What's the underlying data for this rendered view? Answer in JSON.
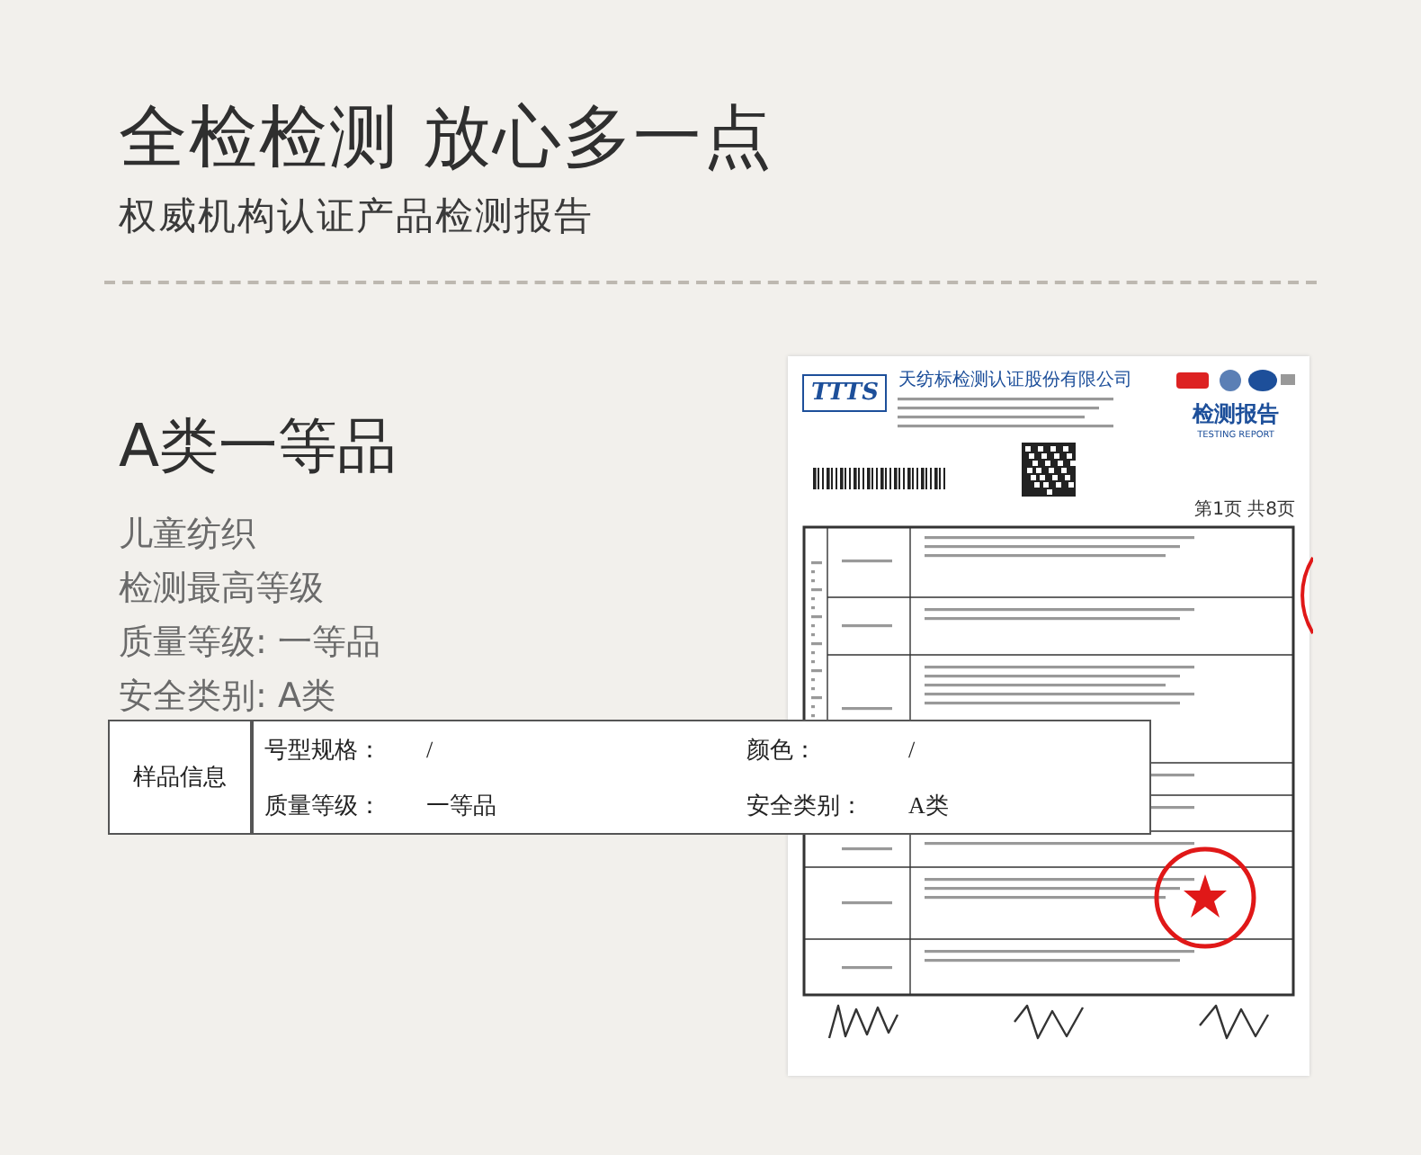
{
  "header": {
    "title": "全检检测 放心多一点",
    "subtitle": "权威机构认证产品检测报告"
  },
  "grade": {
    "title": "A类一等品",
    "items": [
      "儿童纺织",
      "检测最高等级",
      "质量等级: 一等品",
      "安全类别: A类"
    ]
  },
  "report": {
    "logo": "TTTS",
    "company": "天纺标检测认证股份有限公司",
    "title": "检测报告",
    "title_en": "TESTING REPORT",
    "page": "第1页 共8页"
  },
  "sample_info": {
    "label": "样品信息",
    "fields": [
      {
        "label": "号型规格：",
        "value": "/"
      },
      {
        "label": "颜色：",
        "value": "/"
      },
      {
        "label": "质量等级：",
        "value": "一等品"
      },
      {
        "label": "安全类别：",
        "value": "A类"
      }
    ]
  }
}
